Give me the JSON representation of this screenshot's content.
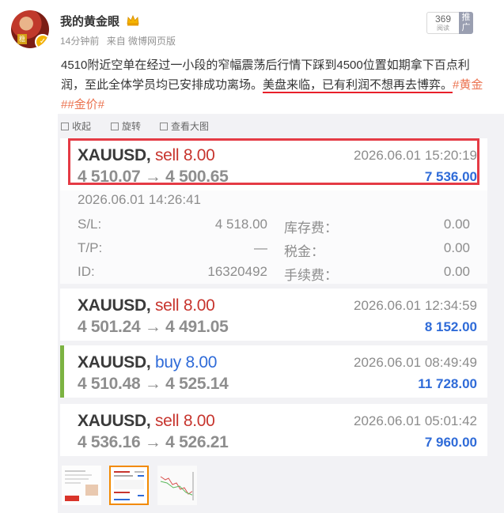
{
  "header": {
    "username": "我的黄金眼",
    "avatar_tag": "稳",
    "time_ago": "14分钟前",
    "source": "来自 微博网页版",
    "read_count": "369",
    "read_label": "阅读",
    "push_label": "推广"
  },
  "post": {
    "text_before": "4510附近空单在经过一小段的窄幅震荡后行情下踩到4500位置如期拿下百点利润，至此全体学员均已安排成功离场。",
    "text_highlight": "美盘来临，已有利润不想再去博弈。",
    "topic1": "#黄金",
    "topic2": "##金价#"
  },
  "toolbar": {
    "collect": "收起",
    "rotate": "旋转",
    "view_large": "查看大图"
  },
  "trades": [
    {
      "symbol": "XAUUSD,",
      "side": "sell",
      "lots": "8.00",
      "open": "4 510.07",
      "close": "4 500.65",
      "time": "2026.06.01 15:20:19",
      "profit": "7 536.00"
    },
    {
      "symbol": "XAUUSD,",
      "side": "sell",
      "lots": "8.00",
      "open": "4 501.24",
      "close": "4 491.05",
      "time": "2026.06.01 12:34:59",
      "profit": "8 152.00"
    },
    {
      "symbol": "XAUUSD,",
      "side": "buy",
      "lots": "8.00",
      "open": "4 510.48",
      "close": "4 525.14",
      "time": "2026.06.01 08:49:49",
      "profit": "11 728.00"
    },
    {
      "symbol": "XAUUSD,",
      "side": "sell",
      "lots": "8.00",
      "open": "4 536.16",
      "close": "4 526.21",
      "time": "2026.06.01 05:01:42",
      "profit": "7 960.00"
    }
  ],
  "detail": {
    "open_time": "2026.06.01 14:26:41",
    "sl_label": "S/L:",
    "sl_value": "4 518.00",
    "tp_label": "T/P:",
    "tp_value": "—",
    "id_label": "ID:",
    "id_value": "16320492",
    "swap_label": "库存费：",
    "swap_value": "0.00",
    "tax_label": "税金：",
    "tax_value": "0.00",
    "fee_label": "手续费：",
    "fee_value": "0.00"
  },
  "arrow": "→",
  "colors": {
    "sell": "#c7352e",
    "buy": "#2f6bd8",
    "highlight": "#e53b45",
    "topic": "#eb7350"
  }
}
